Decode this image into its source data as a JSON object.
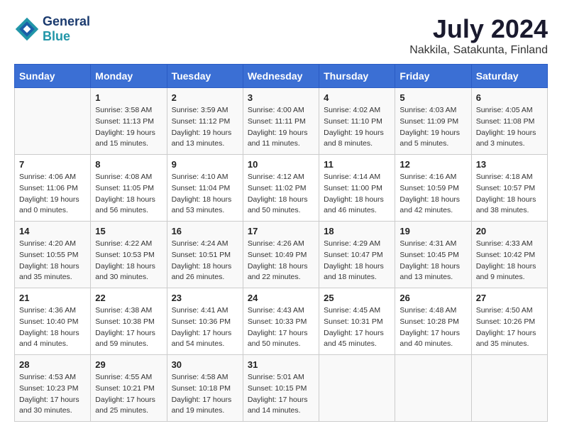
{
  "logo": {
    "line1": "General",
    "line2": "Blue"
  },
  "title": "July 2024",
  "subtitle": "Nakkila, Satakunta, Finland",
  "days_header": [
    "Sunday",
    "Monday",
    "Tuesday",
    "Wednesday",
    "Thursday",
    "Friday",
    "Saturday"
  ],
  "weeks": [
    [
      {
        "day": "",
        "sunrise": "",
        "sunset": "",
        "daylight": ""
      },
      {
        "day": "1",
        "sunrise": "Sunrise: 3:58 AM",
        "sunset": "Sunset: 11:13 PM",
        "daylight": "Daylight: 19 hours and 15 minutes."
      },
      {
        "day": "2",
        "sunrise": "Sunrise: 3:59 AM",
        "sunset": "Sunset: 11:12 PM",
        "daylight": "Daylight: 19 hours and 13 minutes."
      },
      {
        "day": "3",
        "sunrise": "Sunrise: 4:00 AM",
        "sunset": "Sunset: 11:11 PM",
        "daylight": "Daylight: 19 hours and 11 minutes."
      },
      {
        "day": "4",
        "sunrise": "Sunrise: 4:02 AM",
        "sunset": "Sunset: 11:10 PM",
        "daylight": "Daylight: 19 hours and 8 minutes."
      },
      {
        "day": "5",
        "sunrise": "Sunrise: 4:03 AM",
        "sunset": "Sunset: 11:09 PM",
        "daylight": "Daylight: 19 hours and 5 minutes."
      },
      {
        "day": "6",
        "sunrise": "Sunrise: 4:05 AM",
        "sunset": "Sunset: 11:08 PM",
        "daylight": "Daylight: 19 hours and 3 minutes."
      }
    ],
    [
      {
        "day": "7",
        "sunrise": "Sunrise: 4:06 AM",
        "sunset": "Sunset: 11:06 PM",
        "daylight": "Daylight: 19 hours and 0 minutes."
      },
      {
        "day": "8",
        "sunrise": "Sunrise: 4:08 AM",
        "sunset": "Sunset: 11:05 PM",
        "daylight": "Daylight: 18 hours and 56 minutes."
      },
      {
        "day": "9",
        "sunrise": "Sunrise: 4:10 AM",
        "sunset": "Sunset: 11:04 PM",
        "daylight": "Daylight: 18 hours and 53 minutes."
      },
      {
        "day": "10",
        "sunrise": "Sunrise: 4:12 AM",
        "sunset": "Sunset: 11:02 PM",
        "daylight": "Daylight: 18 hours and 50 minutes."
      },
      {
        "day": "11",
        "sunrise": "Sunrise: 4:14 AM",
        "sunset": "Sunset: 11:00 PM",
        "daylight": "Daylight: 18 hours and 46 minutes."
      },
      {
        "day": "12",
        "sunrise": "Sunrise: 4:16 AM",
        "sunset": "Sunset: 10:59 PM",
        "daylight": "Daylight: 18 hours and 42 minutes."
      },
      {
        "day": "13",
        "sunrise": "Sunrise: 4:18 AM",
        "sunset": "Sunset: 10:57 PM",
        "daylight": "Daylight: 18 hours and 38 minutes."
      }
    ],
    [
      {
        "day": "14",
        "sunrise": "Sunrise: 4:20 AM",
        "sunset": "Sunset: 10:55 PM",
        "daylight": "Daylight: 18 hours and 35 minutes."
      },
      {
        "day": "15",
        "sunrise": "Sunrise: 4:22 AM",
        "sunset": "Sunset: 10:53 PM",
        "daylight": "Daylight: 18 hours and 30 minutes."
      },
      {
        "day": "16",
        "sunrise": "Sunrise: 4:24 AM",
        "sunset": "Sunset: 10:51 PM",
        "daylight": "Daylight: 18 hours and 26 minutes."
      },
      {
        "day": "17",
        "sunrise": "Sunrise: 4:26 AM",
        "sunset": "Sunset: 10:49 PM",
        "daylight": "Daylight: 18 hours and 22 minutes."
      },
      {
        "day": "18",
        "sunrise": "Sunrise: 4:29 AM",
        "sunset": "Sunset: 10:47 PM",
        "daylight": "Daylight: 18 hours and 18 minutes."
      },
      {
        "day": "19",
        "sunrise": "Sunrise: 4:31 AM",
        "sunset": "Sunset: 10:45 PM",
        "daylight": "Daylight: 18 hours and 13 minutes."
      },
      {
        "day": "20",
        "sunrise": "Sunrise: 4:33 AM",
        "sunset": "Sunset: 10:42 PM",
        "daylight": "Daylight: 18 hours and 9 minutes."
      }
    ],
    [
      {
        "day": "21",
        "sunrise": "Sunrise: 4:36 AM",
        "sunset": "Sunset: 10:40 PM",
        "daylight": "Daylight: 18 hours and 4 minutes."
      },
      {
        "day": "22",
        "sunrise": "Sunrise: 4:38 AM",
        "sunset": "Sunset: 10:38 PM",
        "daylight": "Daylight: 17 hours and 59 minutes."
      },
      {
        "day": "23",
        "sunrise": "Sunrise: 4:41 AM",
        "sunset": "Sunset: 10:36 PM",
        "daylight": "Daylight: 17 hours and 54 minutes."
      },
      {
        "day": "24",
        "sunrise": "Sunrise: 4:43 AM",
        "sunset": "Sunset: 10:33 PM",
        "daylight": "Daylight: 17 hours and 50 minutes."
      },
      {
        "day": "25",
        "sunrise": "Sunrise: 4:45 AM",
        "sunset": "Sunset: 10:31 PM",
        "daylight": "Daylight: 17 hours and 45 minutes."
      },
      {
        "day": "26",
        "sunrise": "Sunrise: 4:48 AM",
        "sunset": "Sunset: 10:28 PM",
        "daylight": "Daylight: 17 hours and 40 minutes."
      },
      {
        "day": "27",
        "sunrise": "Sunrise: 4:50 AM",
        "sunset": "Sunset: 10:26 PM",
        "daylight": "Daylight: 17 hours and 35 minutes."
      }
    ],
    [
      {
        "day": "28",
        "sunrise": "Sunrise: 4:53 AM",
        "sunset": "Sunset: 10:23 PM",
        "daylight": "Daylight: 17 hours and 30 minutes."
      },
      {
        "day": "29",
        "sunrise": "Sunrise: 4:55 AM",
        "sunset": "Sunset: 10:21 PM",
        "daylight": "Daylight: 17 hours and 25 minutes."
      },
      {
        "day": "30",
        "sunrise": "Sunrise: 4:58 AM",
        "sunset": "Sunset: 10:18 PM",
        "daylight": "Daylight: 17 hours and 19 minutes."
      },
      {
        "day": "31",
        "sunrise": "Sunrise: 5:01 AM",
        "sunset": "Sunset: 10:15 PM",
        "daylight": "Daylight: 17 hours and 14 minutes."
      },
      {
        "day": "",
        "sunrise": "",
        "sunset": "",
        "daylight": ""
      },
      {
        "day": "",
        "sunrise": "",
        "sunset": "",
        "daylight": ""
      },
      {
        "day": "",
        "sunrise": "",
        "sunset": "",
        "daylight": ""
      }
    ]
  ]
}
